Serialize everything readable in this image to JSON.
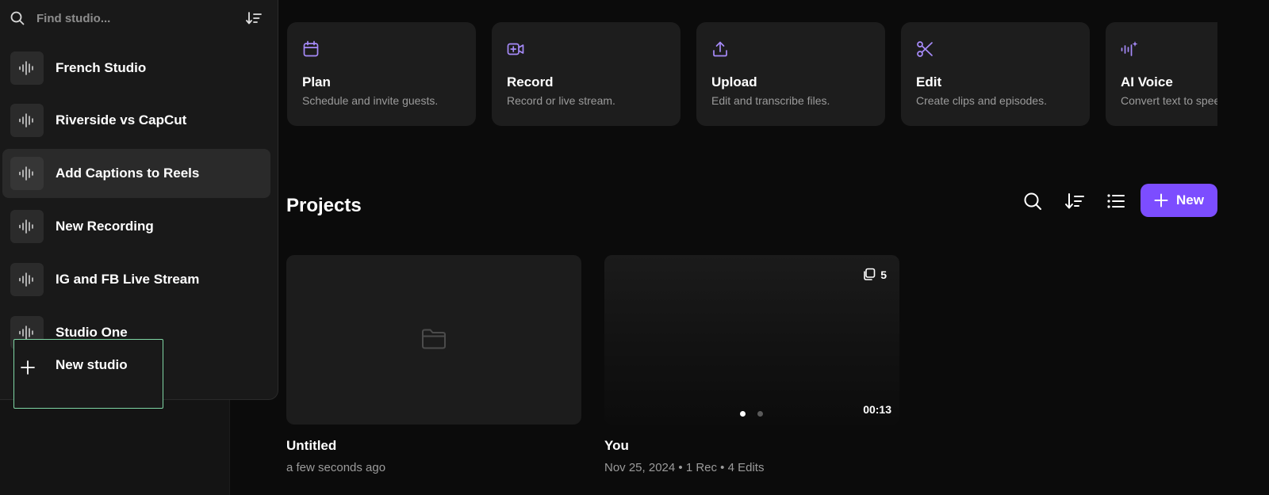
{
  "studio_panel": {
    "search_placeholder": "Find studio...",
    "studios": [
      {
        "label": "French Studio",
        "active": false
      },
      {
        "label": "Riverside vs CapCut",
        "active": false
      },
      {
        "label": "Add Captions to Reels",
        "active": true
      },
      {
        "label": "New Recording",
        "active": false
      },
      {
        "label": "IG and FB Live Stream",
        "active": false
      },
      {
        "label": "Studio One",
        "active": false
      }
    ],
    "new_studio_label": "New studio"
  },
  "actions": [
    {
      "icon": "calendar-icon",
      "title": "Plan",
      "desc": "Schedule and invite guests."
    },
    {
      "icon": "video-plus-icon",
      "title": "Record",
      "desc": "Record or live stream."
    },
    {
      "icon": "upload-icon",
      "title": "Upload",
      "desc": "Edit and transcribe files."
    },
    {
      "icon": "scissors-icon",
      "title": "Edit",
      "desc": "Create clips and episodes."
    },
    {
      "icon": "ai-voice-icon",
      "title": "AI Voice",
      "desc": "Convert text to speech."
    }
  ],
  "projects": {
    "title": "Projects",
    "new_button_label": "New",
    "items": [
      {
        "title": "Untitled",
        "meta": "a few seconds ago"
      },
      {
        "title": "You",
        "meta": "Nov 25, 2024 • 1 Rec • 4 Edits",
        "count": "5",
        "duration": "00:13"
      }
    ]
  },
  "colors": {
    "accent": "#7c4dff",
    "icon_purple": "#a78bfa",
    "focus_outline": "#7fd6a4"
  }
}
